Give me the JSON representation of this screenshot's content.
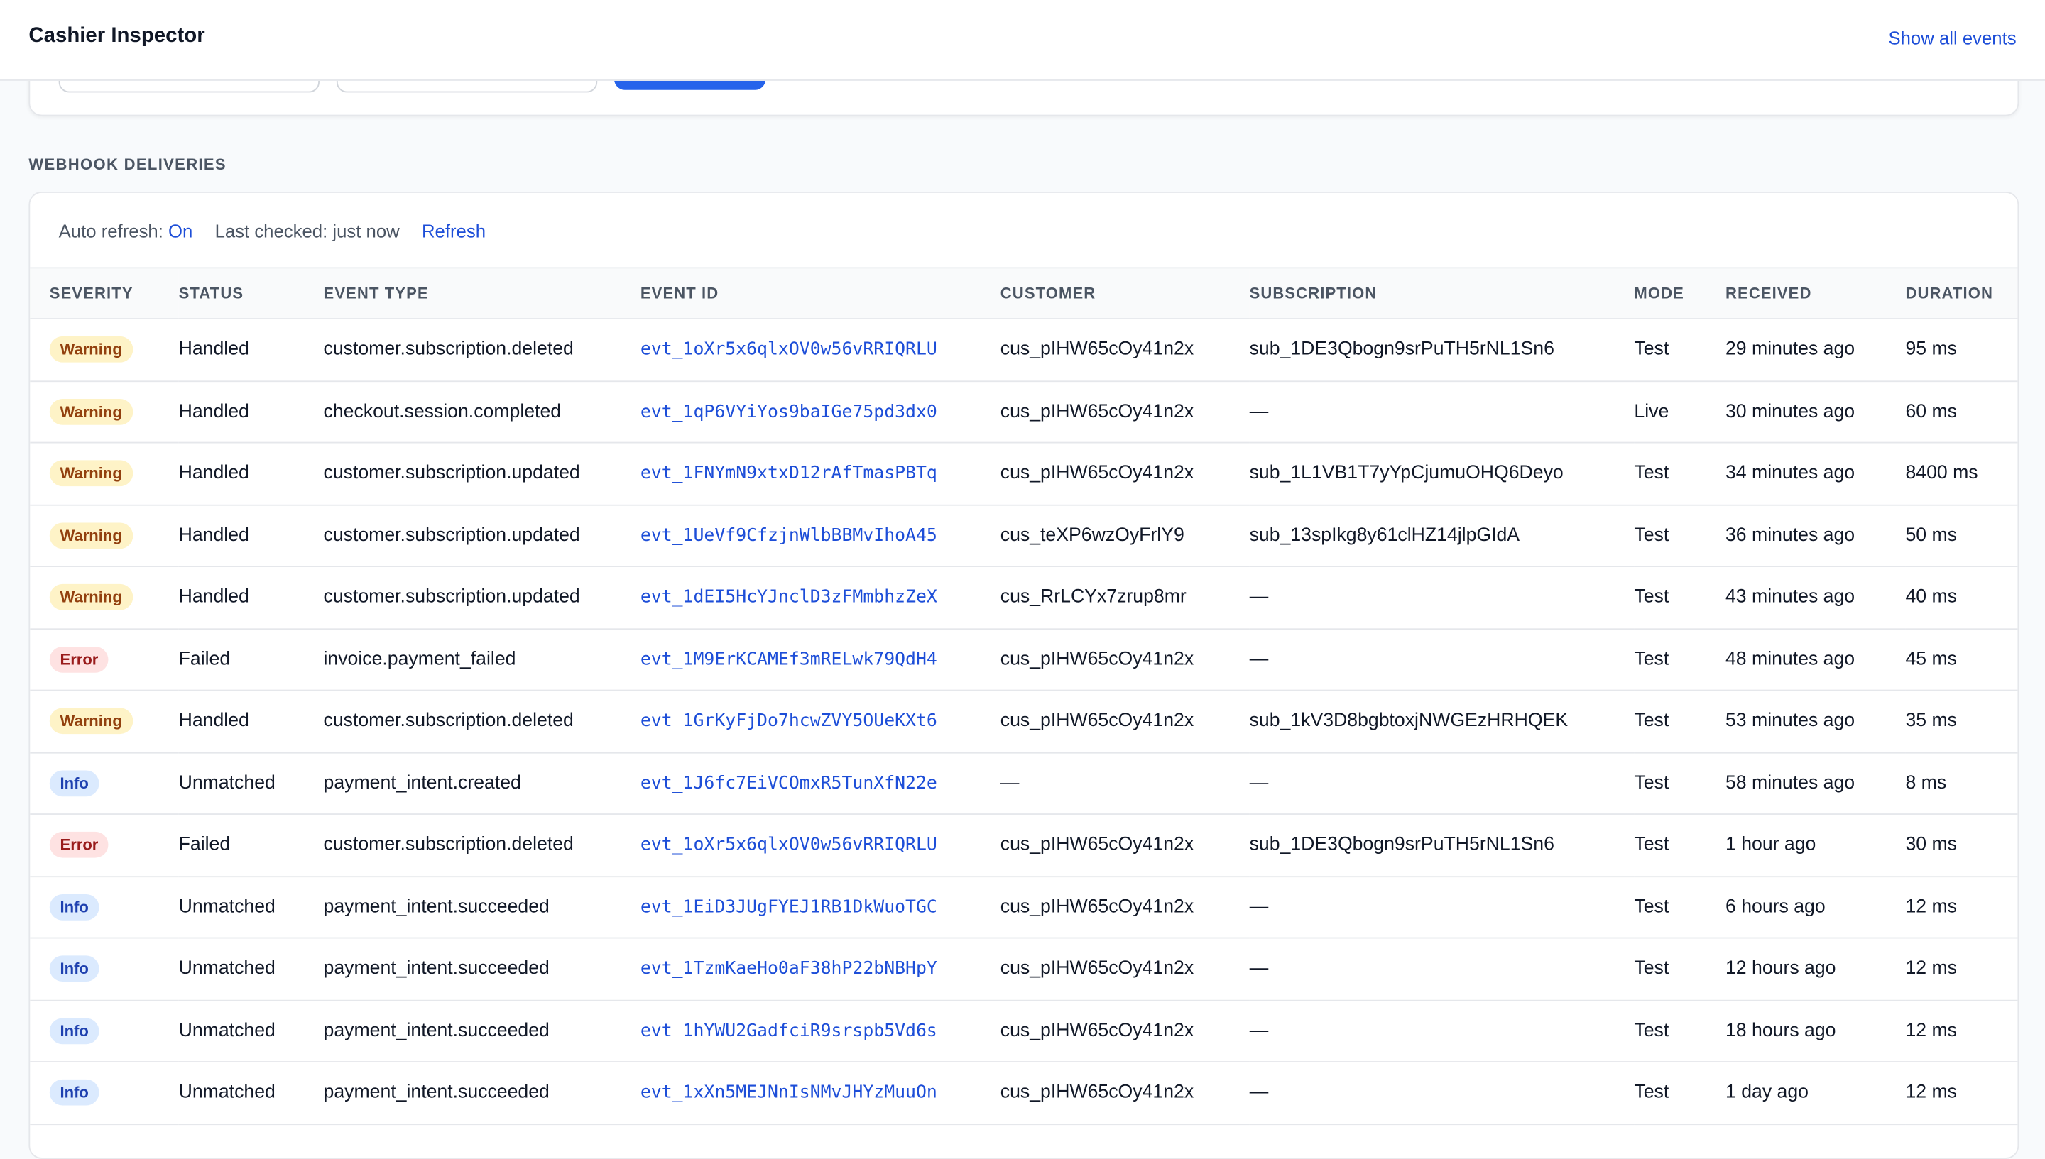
{
  "header": {
    "title": "Cashier Inspector",
    "show_all_label": "Show all events"
  },
  "section": {
    "title": "WEBHOOK DELIVERIES"
  },
  "refresh_bar": {
    "auto_refresh_label": "Auto refresh:",
    "auto_refresh_value": "On",
    "last_checked": "Last checked: just now",
    "refresh_label": "Refresh"
  },
  "table": {
    "columns": [
      "SEVERITY",
      "STATUS",
      "EVENT TYPE",
      "EVENT ID",
      "CUSTOMER",
      "SUBSCRIPTION",
      "MODE",
      "RECEIVED",
      "DURATION"
    ],
    "rows": [
      {
        "severity": "Warning",
        "level": "warning",
        "status": "Handled",
        "event_type": "customer.subscription.deleted",
        "event_id": "evt_1oXr5x6qlxOV0w56vRRIQRLU",
        "customer": "cus_pIHW65cOy41n2x",
        "subscription": "sub_1DE3Qbogn9srPuTH5rNL1Sn6",
        "mode": "Test",
        "received": "29 minutes ago",
        "duration": "95 ms"
      },
      {
        "severity": "Warning",
        "level": "warning",
        "status": "Handled",
        "event_type": "checkout.session.completed",
        "event_id": "evt_1qP6VYiYos9baIGe75pd3dx0",
        "customer": "cus_pIHW65cOy41n2x",
        "subscription": "—",
        "mode": "Live",
        "received": "30 minutes ago",
        "duration": "60 ms"
      },
      {
        "severity": "Warning",
        "level": "warning",
        "status": "Handled",
        "event_type": "customer.subscription.updated",
        "event_id": "evt_1FNYmN9xtxD12rAfTmasPBTq",
        "customer": "cus_pIHW65cOy41n2x",
        "subscription": "sub_1L1VB1T7yYpCjumuOHQ6Deyo",
        "mode": "Test",
        "received": "34 minutes ago",
        "duration": "8400 ms"
      },
      {
        "severity": "Warning",
        "level": "warning",
        "status": "Handled",
        "event_type": "customer.subscription.updated",
        "event_id": "evt_1UeVf9CfzjnWlbBBMvIhoA45",
        "customer": "cus_teXP6wzOyFrlY9",
        "subscription": "sub_13spIkg8y61clHZ14jlpGIdA",
        "mode": "Test",
        "received": "36 minutes ago",
        "duration": "50 ms"
      },
      {
        "severity": "Warning",
        "level": "warning",
        "status": "Handled",
        "event_type": "customer.subscription.updated",
        "event_id": "evt_1dEI5HcYJnclD3zFMmbhzZeX",
        "customer": "cus_RrLCYx7zrup8mr",
        "subscription": "—",
        "mode": "Test",
        "received": "43 minutes ago",
        "duration": "40 ms"
      },
      {
        "severity": "Error",
        "level": "error",
        "status": "Failed",
        "event_type": "invoice.payment_failed",
        "event_id": "evt_1M9ErKCAMEf3mRELwk79QdH4",
        "customer": "cus_pIHW65cOy41n2x",
        "subscription": "—",
        "mode": "Test",
        "received": "48 minutes ago",
        "duration": "45 ms"
      },
      {
        "severity": "Warning",
        "level": "warning",
        "status": "Handled",
        "event_type": "customer.subscription.deleted",
        "event_id": "evt_1GrKyFjDo7hcwZVY5OUeKXt6",
        "customer": "cus_pIHW65cOy41n2x",
        "subscription": "sub_1kV3D8bgbtoxjNWGEzHRHQEK",
        "mode": "Test",
        "received": "53 minutes ago",
        "duration": "35 ms"
      },
      {
        "severity": "Info",
        "level": "info",
        "status": "Unmatched",
        "event_type": "payment_intent.created",
        "event_id": "evt_1J6fc7EiVCOmxR5TunXfN22e",
        "customer": "—",
        "subscription": "—",
        "mode": "Test",
        "received": "58 minutes ago",
        "duration": "8 ms"
      },
      {
        "severity": "Error",
        "level": "error",
        "status": "Failed",
        "event_type": "customer.subscription.deleted",
        "event_id": "evt_1oXr5x6qlxOV0w56vRRIQRLU",
        "customer": "cus_pIHW65cOy41n2x",
        "subscription": "sub_1DE3Qbogn9srPuTH5rNL1Sn6",
        "mode": "Test",
        "received": "1 hour ago",
        "duration": "30 ms"
      },
      {
        "severity": "Info",
        "level": "info",
        "status": "Unmatched",
        "event_type": "payment_intent.succeeded",
        "event_id": "evt_1EiD3JUgFYEJ1RB1DkWuoTGC",
        "customer": "cus_pIHW65cOy41n2x",
        "subscription": "—",
        "mode": "Test",
        "received": "6 hours ago",
        "duration": "12 ms"
      },
      {
        "severity": "Info",
        "level": "info",
        "status": "Unmatched",
        "event_type": "payment_intent.succeeded",
        "event_id": "evt_1TzmKaeHo0aF38hP22bNBHpY",
        "customer": "cus_pIHW65cOy41n2x",
        "subscription": "—",
        "mode": "Test",
        "received": "12 hours ago",
        "duration": "12 ms"
      },
      {
        "severity": "Info",
        "level": "info",
        "status": "Unmatched",
        "event_type": "payment_intent.succeeded",
        "event_id": "evt_1hYWU2GadfciR9srspb5Vd6s",
        "customer": "cus_pIHW65cOy41n2x",
        "subscription": "—",
        "mode": "Test",
        "received": "18 hours ago",
        "duration": "12 ms"
      },
      {
        "severity": "Info",
        "level": "info",
        "status": "Unmatched",
        "event_type": "payment_intent.succeeded",
        "event_id": "evt_1xXn5MEJNnIsNMvJHYzMuuOn",
        "customer": "cus_pIHW65cOy41n2x",
        "subscription": "—",
        "mode": "Test",
        "received": "1 day ago",
        "duration": "12 ms"
      }
    ]
  }
}
